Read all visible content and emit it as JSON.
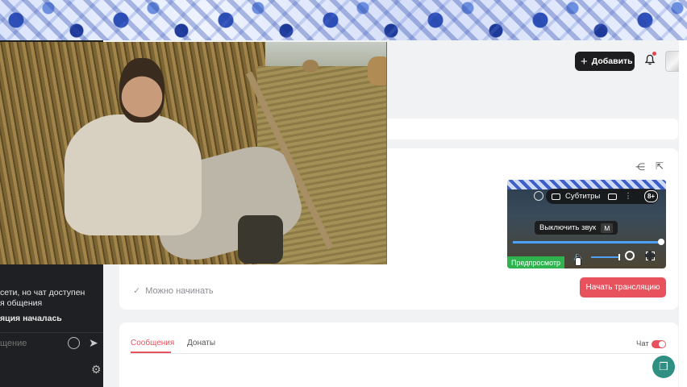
{
  "chat_panel": {
    "message_1_line_1": "сети, но чат доступен",
    "message_1_line_2": "я общения",
    "message_2": "яция началась",
    "input_placeholder": "щение",
    "send_icon": "send-icon",
    "settings_icon": "gear-icon"
  },
  "header": {
    "add_label": "Добавить",
    "add_icon": "plus-icon",
    "notifications_icon": "bell-icon"
  },
  "stream": {
    "ready_text": "Можно начинать",
    "start_label": "Начать трансляцию"
  },
  "preview": {
    "subtitles_label": "Субтитры",
    "age_badge": "8+",
    "tooltip_text": "Выключить звук",
    "tooltip_key": "M",
    "label": "Предпросмотр"
  },
  "tabs": {
    "messages": "Сообщения",
    "donates": "Донаты",
    "chat_toggle_label": "Чат"
  },
  "colors": {
    "accent_red": "#e8525d",
    "dark_button": "#1e1e20",
    "preview_green": "#2eb34e",
    "help_teal": "#2f8f83"
  }
}
